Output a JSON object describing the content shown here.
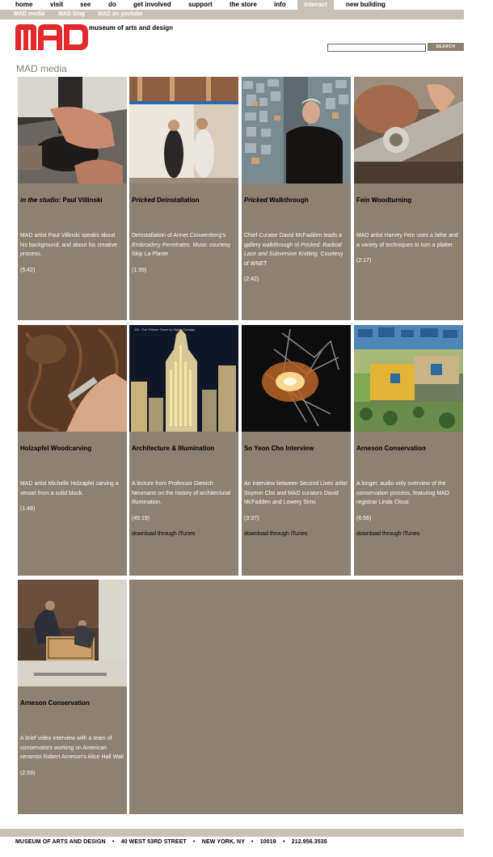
{
  "nav": {
    "items": [
      "home",
      "visit",
      "see",
      "do",
      "get involved",
      "support",
      "the store",
      "info",
      "interact",
      "new building"
    ],
    "active": "interact"
  },
  "subnav": {
    "items": [
      "MAD media",
      "MAD blog",
      "MAD on youtube"
    ]
  },
  "brand": {
    "logo_text": "MAD",
    "tagline": "museum of arts and design",
    "logo_color": "#e3292b"
  },
  "search": {
    "value": "",
    "button_label": "SEARCH"
  },
  "page": {
    "title": "MAD media"
  },
  "cards": [
    {
      "title_italic": "in the studio:",
      "title_rest": " Paul Villinski",
      "desc_parts": [
        {
          "t": "MAD artist Paul Villinski speaks about his background, and about his creative process.",
          "i": false
        }
      ],
      "duration": "(5:42)",
      "download": ""
    },
    {
      "title_italic": "Pricked",
      "title_rest": " Deinstallation",
      "desc_parts": [
        {
          "t": "Deinstallation of Annet Couwenberg's ",
          "i": false
        },
        {
          "t": "Embroidery Penetrates",
          "i": true
        },
        {
          "t": ". Music courtesy Skip La Plante",
          "i": false
        }
      ],
      "duration": "(1:39)",
      "download": ""
    },
    {
      "title_italic": "Pricked",
      "title_rest": " Walkthrough",
      "desc_parts": [
        {
          "t": "Chief Curator David McFadden leads a gallery walkthrough of ",
          "i": false
        },
        {
          "t": "Pricked: Radical Lace and Subversive Knitting",
          "i": true
        },
        {
          "t": ". Courtesy of WNET",
          "i": false
        }
      ],
      "duration": "(2:42)",
      "download": ""
    },
    {
      "title_italic": "",
      "title_rest": "Fein Woodturning",
      "desc_parts": [
        {
          "t": "MAD artist Harvey Fein uses a lathe and a variety of techniques to turn a platter",
          "i": false
        }
      ],
      "duration": "(2:17)",
      "download": ""
    },
    {
      "title_italic": "",
      "title_rest": "Holzapfel Woodcarving",
      "desc_parts": [
        {
          "t": "MAD artist Michelle Holzapfel carving a vessel from a solid block.",
          "i": false
        }
      ],
      "duration": "(1:48)",
      "download": ""
    },
    {
      "title_italic": "",
      "title_rest": "Architecture & Illumination",
      "desc_parts": [
        {
          "t": "A lecture from Professor Dietrich Neumann on the history of architectural illumination.",
          "i": false
        }
      ],
      "duration": "(45:19)",
      "download": "download through iTunes"
    },
    {
      "title_italic": "",
      "title_rest": "So Yeon Cho Interview",
      "desc_parts": [
        {
          "t": "An interview between Second Lives artist Soyeon Cho and MAD curators David McFadden and Lowery Sims",
          "i": false
        }
      ],
      "duration": "(3:37)",
      "download": "download through iTunes"
    },
    {
      "title_italic": "",
      "title_rest": "Arneson Conservation",
      "desc_parts": [
        {
          "t": "A longer, audio-only overview of the conservation process, featuring MAD registrar Linda Clous",
          "i": false
        }
      ],
      "duration": "(6:56)",
      "download": "download through iTunes"
    },
    {
      "title_italic": "",
      "title_rest": "Arneson Conservation",
      "desc_parts": [
        {
          "t": "A brief video interview with a team of conservators working on American ceramist Robert Arneson's Alice Hall Wall",
          "i": false
        }
      ],
      "duration": "(2:59)",
      "download": ""
    }
  ],
  "postcard_caption": "101 -The Tribune Tower by Night, Chicago",
  "footer": {
    "parts": [
      "MUSEUM OF ARTS AND DESIGN",
      "40 WEST 53RD STREET",
      "NEW YORK, NY",
      "10019",
      "212.956.3535"
    ],
    "separator": "•"
  },
  "colors": {
    "card_bg": "#8d8170",
    "bar_bg": "#c9c1b5",
    "title_color": "#8d8170"
  }
}
